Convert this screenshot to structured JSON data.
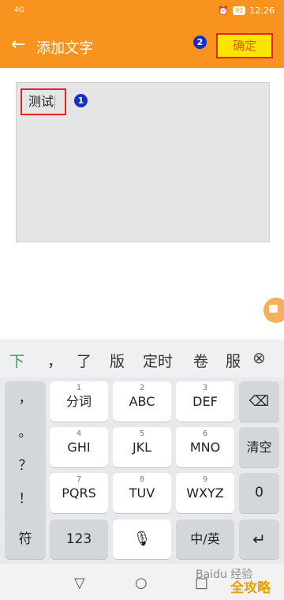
{
  "status_bar": {
    "signal": "4G",
    "alarm_icon": "alarm-icon",
    "battery": "92",
    "time": "12:26"
  },
  "header": {
    "title": "添加文字",
    "confirm": "确定"
  },
  "annotations": [
    "1",
    "2"
  ],
  "editor": {
    "text": "测试"
  },
  "candidates": [
    "下",
    "，",
    "了",
    "版",
    "定时",
    "卷",
    "服"
  ],
  "keyboard": {
    "symbols": [
      "，",
      "。",
      "？",
      "！"
    ],
    "row1": [
      {
        "num": "1",
        "label": "分词"
      },
      {
        "num": "2",
        "label": "ABC"
      },
      {
        "num": "3",
        "label": "DEF"
      }
    ],
    "row2": [
      {
        "num": "4",
        "label": "GHI"
      },
      {
        "num": "5",
        "label": "JKL"
      },
      {
        "num": "6",
        "label": "MNO"
      }
    ],
    "row3": [
      {
        "num": "7",
        "label": "PQRS"
      },
      {
        "num": "8",
        "label": "TUV"
      },
      {
        "num": "9",
        "label": "WXYZ"
      }
    ],
    "clear": "清空",
    "zero": "0",
    "symbol_key": "符",
    "num_key": "123",
    "lang_key": "中/英"
  },
  "watermark": {
    "text": "Baidu 经验",
    "brand": "全攻略"
  },
  "colors": {
    "accent": "#f7931e",
    "confirm_bg": "#ffe400",
    "highlight": "#e52323",
    "badge": "#1430c8"
  }
}
